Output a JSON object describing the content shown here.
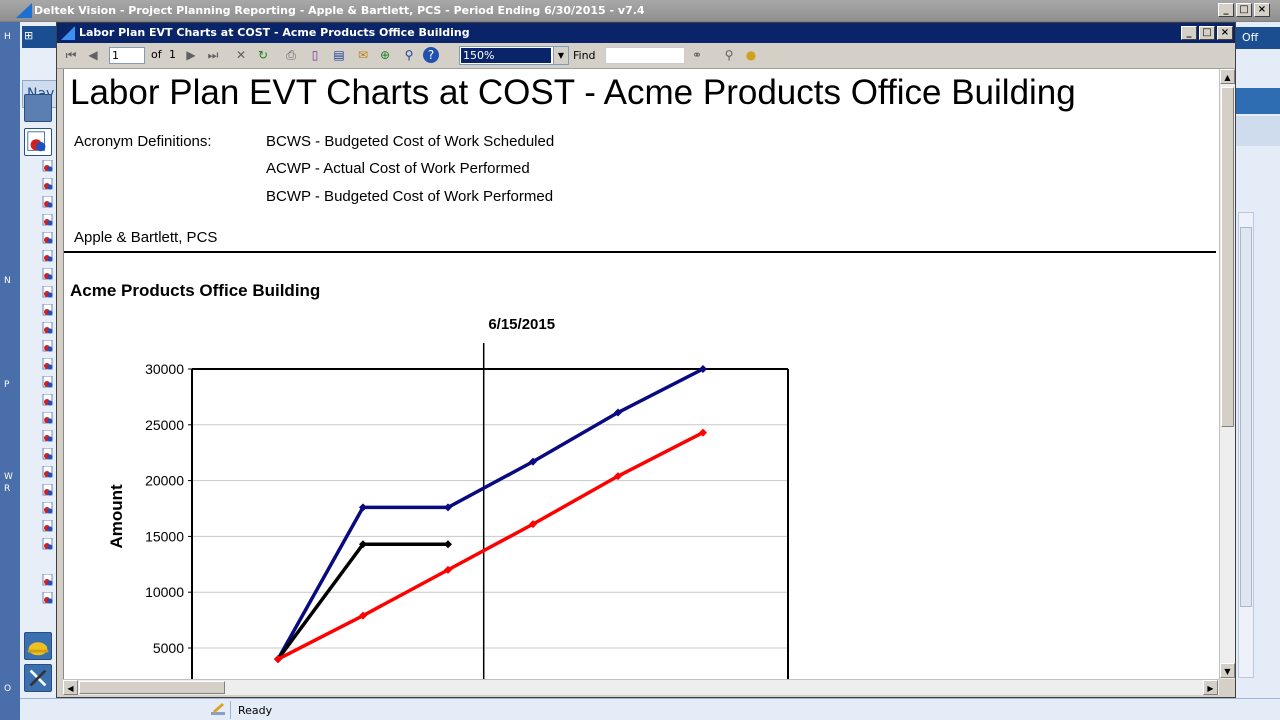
{
  "outer_window": {
    "title": "Deltek Vision - Project Planning Reporting - Apple & Bartlett, PCS - Period Ending 6/30/2015 - v7.4",
    "minimize": "_",
    "maximize": "□",
    "close": "×",
    "nav_label": "Nav",
    "off_label": "Off",
    "side_letters": [
      "H",
      "N",
      "P",
      "W",
      "R",
      "O"
    ]
  },
  "viewer": {
    "title": "Labor Plan EVT Charts at COST - Acme Products Office Building",
    "toolbar": {
      "page": "1",
      "of_label": "of",
      "page_count": "1",
      "zoom": "150%",
      "find_label": "Find"
    }
  },
  "report": {
    "title": "Labor Plan EVT Charts at COST - Acme Products Office Building",
    "acronym_label": "Acronym Definitions:",
    "acronyms": [
      "BCWS - Budgeted Cost of Work Scheduled",
      "ACWP - Actual Cost of Work Performed",
      "BCWP - Budgeted Cost of Work Performed"
    ],
    "company": "Apple & Bartlett, PCS",
    "chart_heading": "Acme Products Office Building"
  },
  "chart_data": {
    "type": "line",
    "title": "",
    "ylabel": "Amount",
    "ylim": [
      4000,
      30500
    ],
    "y_ticks": [
      5000,
      10000,
      15000,
      20000,
      25000,
      30000
    ],
    "marker_label": "6/15/2015",
    "marker_x": 3.42,
    "x": [
      1,
      2,
      3,
      4,
      5,
      6
    ],
    "series": [
      {
        "color": "#0a0a80",
        "values": [
          4000,
          17600,
          17600,
          21700,
          26100,
          30000
        ]
      },
      {
        "color": "#000000",
        "values": [
          4000,
          14300,
          14300,
          null,
          null,
          null
        ]
      },
      {
        "color": "#ff0000",
        "values": [
          4000,
          7900,
          12000,
          16100,
          20400,
          24300
        ]
      }
    ]
  },
  "status": {
    "text": "Ready"
  }
}
